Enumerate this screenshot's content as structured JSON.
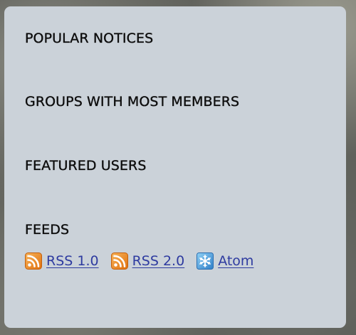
{
  "sections": {
    "popular_notices": "POPULAR NOTICES",
    "groups_most_members": "GROUPS WITH MOST MEMBERS",
    "featured_users": "FEATURED USERS",
    "feeds": "FEEDS"
  },
  "feeds": [
    {
      "label": "RSS 1.0",
      "icon": "rss-icon"
    },
    {
      "label": "RSS 2.0",
      "icon": "rss-icon"
    },
    {
      "label": "Atom",
      "icon": "atom-icon"
    }
  ],
  "colors": {
    "panel_bg": "#cbd2d9",
    "link": "#2e3ba0",
    "rss_orange": "#f08a1c",
    "atom_blue": "#3b8fd6"
  }
}
